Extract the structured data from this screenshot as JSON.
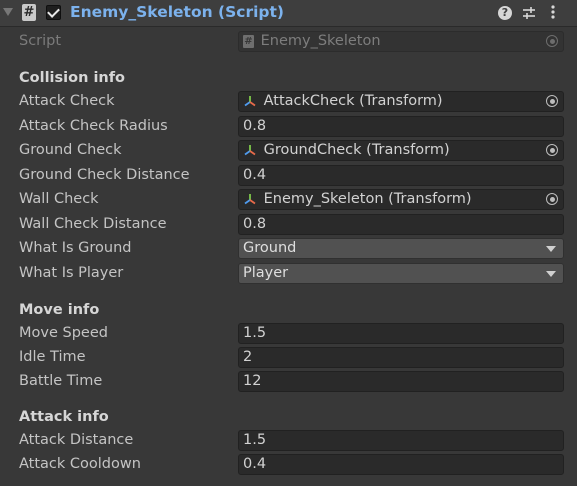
{
  "component": {
    "title": "Enemy_Skeleton (Script)",
    "enabled": true,
    "icon": "#"
  },
  "header_icons": [
    "help-icon",
    "preset-icon",
    "menu-icon"
  ],
  "script_field": {
    "label": "Script",
    "value": "Enemy_Skeleton"
  },
  "collision": {
    "heading": "Collision info",
    "attack_check": {
      "label": "Attack Check",
      "value": "AttackCheck (Transform)"
    },
    "attack_check_radius": {
      "label": "Attack Check Radius",
      "value": "0.8"
    },
    "ground_check": {
      "label": "Ground Check",
      "value": "GroundCheck (Transform)"
    },
    "ground_check_distance": {
      "label": "Ground Check Distance",
      "value": "0.4"
    },
    "wall_check": {
      "label": "Wall Check",
      "value": "Enemy_Skeleton (Transform)"
    },
    "wall_check_distance": {
      "label": "Wall Check Distance",
      "value": "0.8"
    },
    "what_is_ground": {
      "label": "What Is Ground",
      "value": "Ground"
    },
    "what_is_player": {
      "label": "What Is Player",
      "value": "Player"
    }
  },
  "move": {
    "heading": "Move info",
    "move_speed": {
      "label": "Move Speed",
      "value": "1.5"
    },
    "idle_time": {
      "label": "Idle Time",
      "value": "2"
    },
    "battle_time": {
      "label": "Battle Time",
      "value": "12"
    }
  },
  "attack": {
    "heading": "Attack info",
    "attack_distance": {
      "label": "Attack Distance",
      "value": "1.5"
    },
    "attack_cooldown": {
      "label": "Attack Cooldown",
      "value": "0.4"
    }
  },
  "colors": {
    "title_blue": "#7cb2ed",
    "panel_bg": "#383838",
    "field_bg": "#2a2a2a",
    "dropdown_bg": "#515151"
  }
}
